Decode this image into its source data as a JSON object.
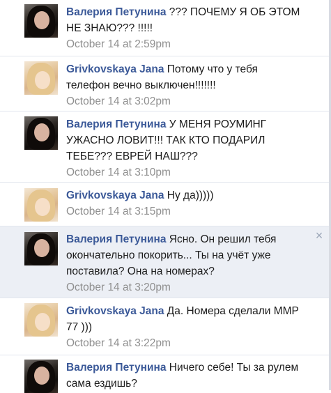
{
  "messages": [
    {
      "author": "Валерия Петунина",
      "text": "??? ПОЧЕМУ Я ОБ ЭТОМ НЕ ЗНАЮ??? !!!!!",
      "time": "October 14 at 2:59pm",
      "avatar": "dark-haired-woman-avatar"
    },
    {
      "author": "Grivkovskaya Jana",
      "text": "Потому что у тебя телефон вечно выключен!!!!!!!",
      "time": "October 14 at 3:02pm",
      "avatar": "blonde-woman-avatar"
    },
    {
      "author": "Валерия Петунина",
      "text": "У МЕНЯ РОУМИНГ УЖАСНО ЛОВИТ!!! ТАК КТО ПОДАРИЛ ТЕБЕ??? ЕВРЕЙ НАШ???",
      "time": "October 14 at 3:10pm",
      "avatar": "dark-haired-woman-avatar"
    },
    {
      "author": "Grivkovskaya Jana",
      "text": "Ну да)))))",
      "time": "October 14 at 3:15pm",
      "avatar": "blonde-woman-avatar"
    },
    {
      "author": "Валерия Петунина",
      "text": "Ясно. Он решил тебя окончательно покорить... Ты на учёт уже поставила? Она на номерах?",
      "time": "October 14 at 3:20pm",
      "avatar": "dark-haired-woman-avatar",
      "close_icon": "×"
    },
    {
      "author": "Grivkovskaya Jana",
      "text": "Да. Номера сделали ММР 77 )))",
      "time": "October 14 at 3:22pm",
      "avatar": "blonde-woman-avatar"
    },
    {
      "author": "Валерия Петунина",
      "text": "Ничего себе! Ты за рулем сама ездишь?",
      "time": "",
      "avatar": "dark-haired-woman-avatar"
    }
  ],
  "colors": {
    "author": "#3b5998",
    "timestamp": "#8f8f8f",
    "highlight": "#eceff5"
  }
}
